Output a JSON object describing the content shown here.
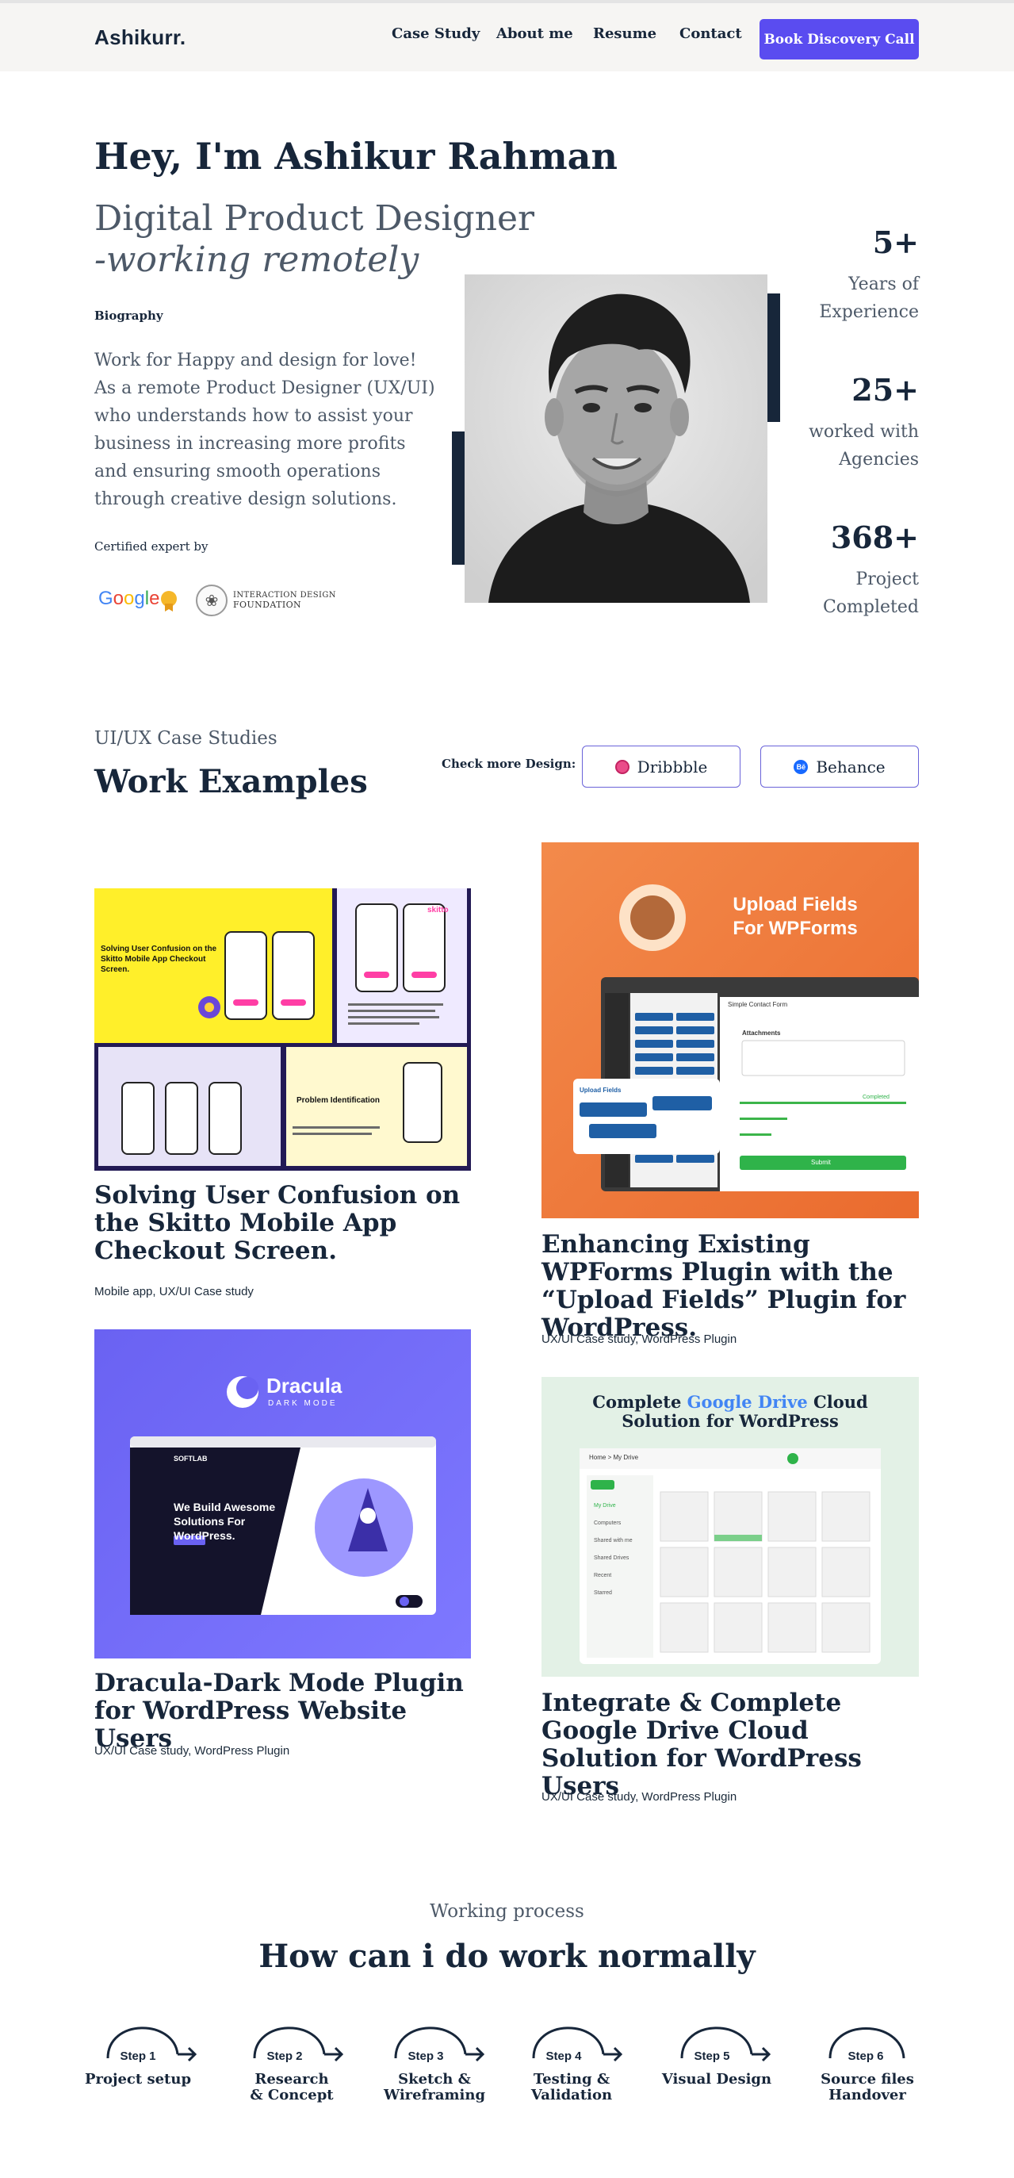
{
  "header": {
    "logo": "Ashikurr.",
    "nav": [
      "Case Study",
      "About me",
      "Resume",
      "Contact"
    ],
    "cta_label": "Book Discovery Call",
    "accent": "#5a4cf0"
  },
  "hero": {
    "greeting": "Hey, I'm Ashikur Rahman",
    "role": "Digital Product Designer",
    "role_suffix": "-working remotely",
    "bio_label": "Biography",
    "bio_text": "Work for Happy and design for love! As a remote Product Designer (UX/UI) who understands how to assist your business in increasing more profits and ensuring smooth operations through creative design solutions.",
    "certified_label": "Certified expert by",
    "cert_google": "Google",
    "cert_idf_line1": "INTERACTION DESIGN",
    "cert_idf_line2": "FOUNDATION",
    "stats": [
      {
        "value": "5+",
        "label_line1": "Years of",
        "label_line2": "Experience"
      },
      {
        "value": "25+",
        "label_line1": "worked with",
        "label_line2": "Agencies"
      },
      {
        "value": "368+",
        "label_line1": "Project",
        "label_line2": "Completed"
      }
    ]
  },
  "work": {
    "kicker": "UI/UX Case Studies",
    "title": "Work Examples",
    "check_more_label": "Check more Design:",
    "dribbble_label": "Dribbble",
    "behance_label": "Behance",
    "cards": [
      {
        "title": "Solving User Confusion on the Skitto Mobile App Checkout Screen.",
        "tags": "Mobile app, UX/UI Case study",
        "img_headline": "Solving User Confusion on the Skitto Mobile App Checkout Screen.",
        "img_sub": "Problem Identification",
        "img_brand": "skitto"
      },
      {
        "title": "Enhancing Existing WPForms Plugin with the “Upload Fields” Plugin for WordPress.",
        "tags": "UX/UI Case study, WordPress Plugin",
        "img_headline_line1": "Upload Fields",
        "img_headline_line2": "For WPForms",
        "img_form_title": "Simple Contact Form",
        "img_attachments": "Attachments",
        "img_completed": "Completed",
        "img_submit": "Submit",
        "img_upload_fields": "Upload Fields"
      },
      {
        "title": "Dracula-Dark Mode Plugin for WordPress Website Users",
        "tags": "UX/UI Case study, WordPress Plugin",
        "img_brand": "Dracula",
        "img_brand_sub": "DARK MODE",
        "img_site_logo": "SOFTLAB",
        "img_hero_text": "We Build Awesome Solutions For WordPress."
      },
      {
        "title": "Integrate & Complete Google Drive Cloud Solution for WordPress Users",
        "tags": "UX/UI Case study, WordPress Plugin",
        "img_headline_pre": "Complete",
        "img_headline_google": "Google Drive",
        "img_headline_post": "Cloud",
        "img_headline_line2": "Solution for WordPress",
        "img_breadcrumb": "Home > My Drive",
        "img_sidebar": [
          "My Drive",
          "Computers",
          "Shared with me",
          "Shared Drives",
          "Recent",
          "Starred"
        ]
      }
    ]
  },
  "process": {
    "kicker": "Working process",
    "title": "How can i do work normally",
    "steps": [
      {
        "label": "Step 1",
        "name_line1": "Project setup",
        "name_line2": ""
      },
      {
        "label": "Step 2",
        "name_line1": "Research",
        "name_line2": "& Concept"
      },
      {
        "label": "Step 3",
        "name_line1": "Sketch &",
        "name_line2": "Wireframing"
      },
      {
        "label": "Step 4",
        "name_line1": "Testing &",
        "name_line2": "Validation"
      },
      {
        "label": "Step 5",
        "name_line1": "Visual Design",
        "name_line2": ""
      },
      {
        "label": "Step 6",
        "name_line1": "Source files",
        "name_line2": "Handover"
      }
    ]
  },
  "icons": {
    "dribbble": "dribbble-icon",
    "behance": "behance-icon",
    "step_arrow": "curved-arrow-icon"
  }
}
